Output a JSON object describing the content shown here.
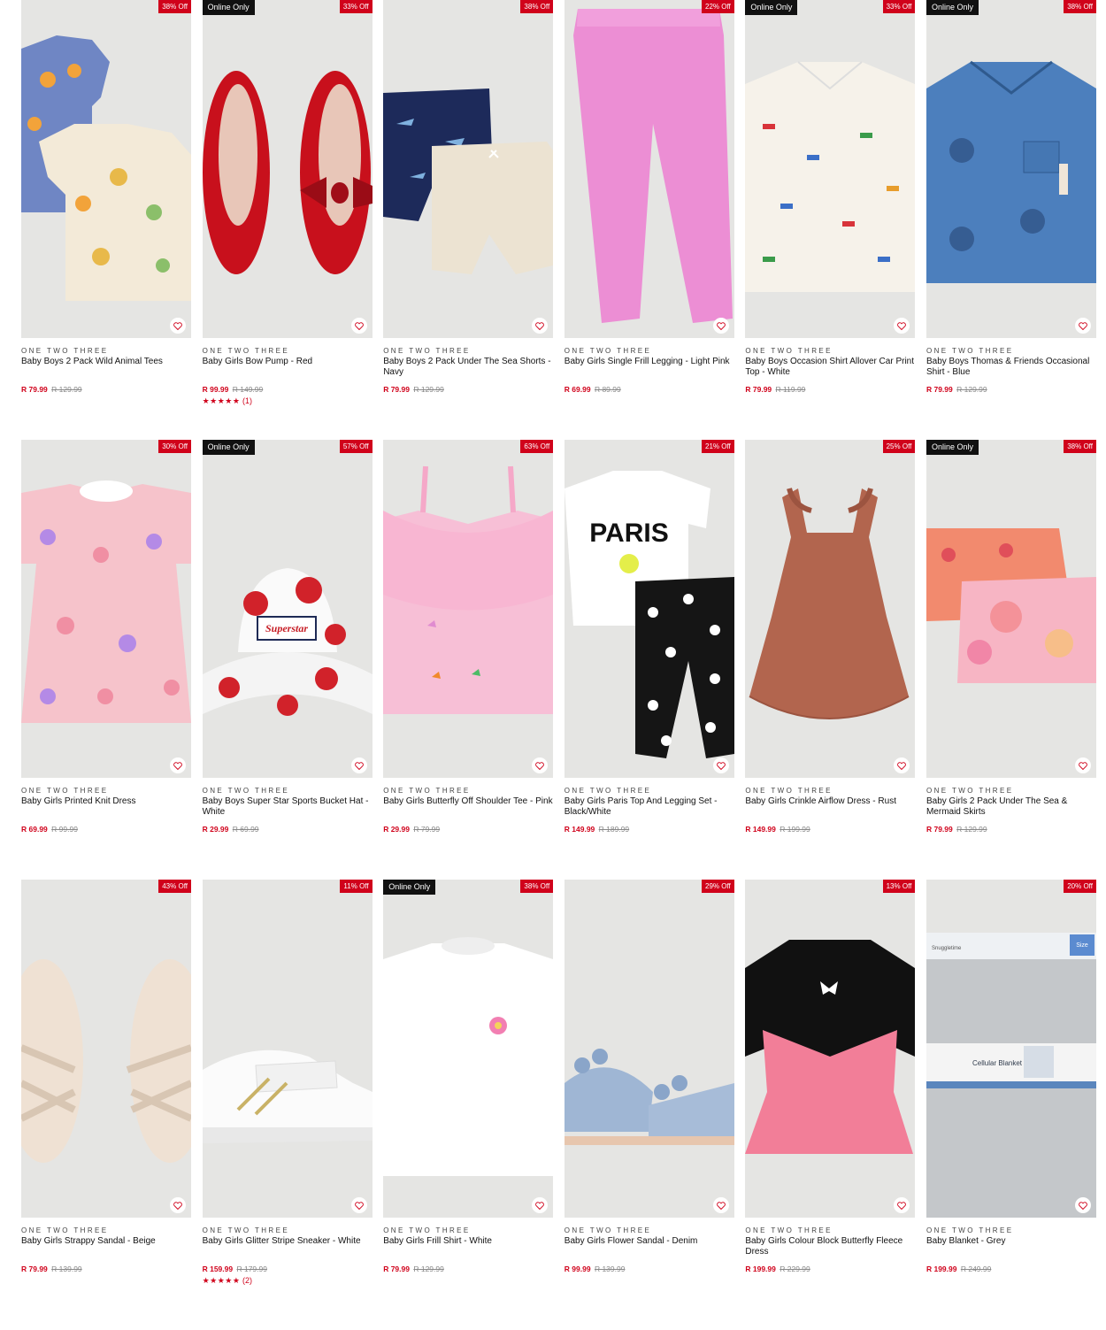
{
  "brand_color": "#d0021b",
  "products": [
    {
      "brand": "ONE TWO THREE",
      "name": "Baby Boys 2 Pack Wild Animal Tees",
      "price": "R 79.99",
      "was": "R 129.99",
      "discount": "38% Off",
      "online_only": "",
      "rating_stars": "",
      "rating_count": ""
    },
    {
      "brand": "ONE TWO THREE",
      "name": "Baby Girls Bow Pump - Red",
      "price": "R 99.99",
      "was": "R 149.99",
      "discount": "33% Off",
      "online_only": "Online Only",
      "rating_stars": "★★★★★",
      "rating_count": "(1)"
    },
    {
      "brand": "ONE TWO THREE",
      "name": "Baby Boys 2 Pack Under The Sea Shorts - Navy",
      "price": "R 79.99",
      "was": "R 129.99",
      "discount": "38% Off",
      "online_only": "",
      "rating_stars": "",
      "rating_count": ""
    },
    {
      "brand": "ONE TWO THREE",
      "name": "Baby Girls Single Frill Legging - Light Pink",
      "price": "R 69.99",
      "was": "R 89.99",
      "discount": "22% Off",
      "online_only": "",
      "rating_stars": "",
      "rating_count": ""
    },
    {
      "brand": "ONE TWO THREE",
      "name": "Baby Boys Occasion Shirt Allover Car Print Top - White",
      "price": "R 79.99",
      "was": "R 119.99",
      "discount": "33% Off",
      "online_only": "Online Only",
      "rating_stars": "",
      "rating_count": ""
    },
    {
      "brand": "ONE TWO THREE",
      "name": "Baby Boys Thomas & Friends Occasional Shirt - Blue",
      "price": "R 79.99",
      "was": "R 129.99",
      "discount": "38% Off",
      "online_only": "Online Only",
      "rating_stars": "",
      "rating_count": ""
    },
    {
      "brand": "ONE TWO THREE",
      "name": "Baby Girls Printed Knit Dress",
      "price": "R 69.99",
      "was": "R 99.99",
      "discount": "30% Off",
      "online_only": "",
      "rating_stars": "",
      "rating_count": ""
    },
    {
      "brand": "ONE TWO THREE",
      "name": "Baby Boys Super Star Sports Bucket Hat - White",
      "price": "R 29.99",
      "was": "R 69.99",
      "discount": "57% Off",
      "online_only": "Online Only",
      "rating_stars": "",
      "rating_count": ""
    },
    {
      "brand": "ONE TWO THREE",
      "name": "Baby Girls Butterfly Off Shoulder Tee - Pink",
      "price": "R 29.99",
      "was": "R 79.99",
      "discount": "63% Off",
      "online_only": "",
      "rating_stars": "",
      "rating_count": ""
    },
    {
      "brand": "ONE TWO THREE",
      "name": "Baby Girls Paris Top And Legging Set - Black/White",
      "price": "R 149.99",
      "was": "R 189.99",
      "discount": "21% Off",
      "online_only": "",
      "rating_stars": "",
      "rating_count": ""
    },
    {
      "brand": "ONE TWO THREE",
      "name": "Baby Girls Crinkle Airflow Dress - Rust",
      "price": "R 149.99",
      "was": "R 199.99",
      "discount": "25% Off",
      "online_only": "",
      "rating_stars": "",
      "rating_count": ""
    },
    {
      "brand": "ONE TWO THREE",
      "name": "Baby Girls 2 Pack Under The Sea & Mermaid Skirts",
      "price": "R 79.99",
      "was": "R 129.99",
      "discount": "38% Off",
      "online_only": "Online Only",
      "rating_stars": "",
      "rating_count": ""
    },
    {
      "brand": "ONE TWO THREE",
      "name": "Baby Girls Strappy Sandal - Beige",
      "price": "R 79.99",
      "was": "R 139.99",
      "discount": "43% Off",
      "online_only": "",
      "rating_stars": "",
      "rating_count": ""
    },
    {
      "brand": "ONE TWO THREE",
      "name": "Baby Girls Glitter Stripe Sneaker - White",
      "price": "R 159.99",
      "was": "R 179.99",
      "discount": "11% Off",
      "online_only": "",
      "rating_stars": "★★★★★",
      "rating_count": "(2)"
    },
    {
      "brand": "ONE TWO THREE",
      "name": "Baby Girls Frill Shirt - White",
      "price": "R 79.99",
      "was": "R 129.99",
      "discount": "38% Off",
      "online_only": "Online Only",
      "rating_stars": "",
      "rating_count": ""
    },
    {
      "brand": "ONE TWO THREE",
      "name": "Baby Girls Flower Sandal - Denim",
      "price": "R 99.99",
      "was": "R 139.99",
      "discount": "29% Off",
      "online_only": "",
      "rating_stars": "",
      "rating_count": ""
    },
    {
      "brand": "ONE TWO THREE",
      "name": "Baby Girls Colour Block Butterfly Fleece Dress",
      "price": "R 199.99",
      "was": "R 229.99",
      "discount": "13% Off",
      "online_only": "",
      "rating_stars": "",
      "rating_count": ""
    },
    {
      "brand": "ONE TWO THREE",
      "name": "Baby Blanket - Grey",
      "price": "R 199.99",
      "was": "R 249.99",
      "discount": "20% Off",
      "online_only": "",
      "rating_stars": "",
      "rating_count": ""
    }
  ],
  "image_text": {
    "paris": "PARIS",
    "superstar": "Superstar",
    "blanket_brand": "Snuggletime",
    "blanket_label": "Cellular Blanket",
    "blanket_size": "Size"
  }
}
